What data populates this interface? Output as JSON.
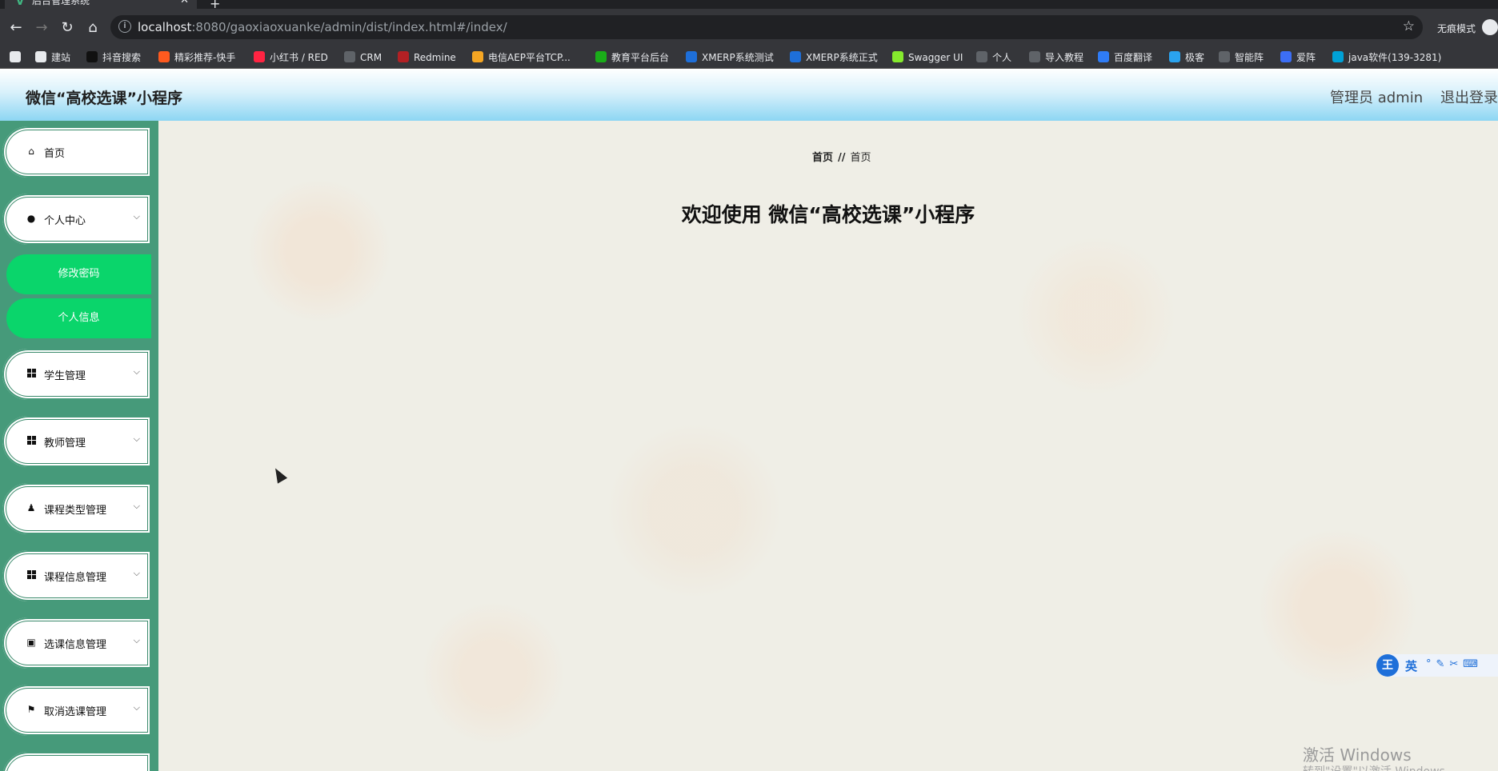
{
  "browser": {
    "tab_title": "后台管理系统",
    "url_host": "localhost",
    "url_path": ":8080/gaoxiaoxuanke/admin/dist/index.html#/index/",
    "incognito_label": "无痕模式",
    "bookmarks": [
      {
        "label": "",
        "icon": "github-icon",
        "color": "#e8eaed"
      },
      {
        "label": "建站",
        "icon": "site-icon",
        "color": "#e8eaed"
      },
      {
        "label": "抖音搜索",
        "icon": "douyin-icon",
        "color": "#111111"
      },
      {
        "label": "精彩推荐-快手",
        "icon": "kuaishou-icon",
        "color": "#ff5a1f"
      },
      {
        "label": "小红书 / RED",
        "icon": "xiaohongshu-icon",
        "color": "#ff2442"
      },
      {
        "label": "CRM",
        "icon": "globe-icon",
        "color": "#5f6368"
      },
      {
        "label": "Redmine",
        "icon": "redmine-icon",
        "color": "#b32024"
      },
      {
        "label": "电信AEP平台TCP...",
        "icon": "aep-icon",
        "color": "#f5a623"
      },
      {
        "label": "教育平台后台",
        "icon": "edu-icon",
        "color": "#1aad19"
      },
      {
        "label": "XMERP系统测试",
        "icon": "xmerp-icon",
        "color": "#1e6fd9"
      },
      {
        "label": "XMERP系统正式",
        "icon": "xmerp-icon",
        "color": "#1e6fd9"
      },
      {
        "label": "Swagger UI",
        "icon": "swagger-icon",
        "color": "#85ea2d"
      },
      {
        "label": "个人",
        "icon": "globe-icon",
        "color": "#5f6368"
      },
      {
        "label": "导入教程",
        "icon": "globe-icon",
        "color": "#5f6368"
      },
      {
        "label": "百度翻译",
        "icon": "baidu-translate-icon",
        "color": "#2f7cf6"
      },
      {
        "label": "极客",
        "icon": "telegram-icon",
        "color": "#2aa3ef"
      },
      {
        "label": "智能阵",
        "icon": "globe-icon",
        "color": "#5f6368"
      },
      {
        "label": "爱阵",
        "icon": "aizhen-icon",
        "color": "#3c6ef5"
      },
      {
        "label": "java软件(139-3281)",
        "icon": "bilibili-icon",
        "color": "#00a1d6"
      }
    ]
  },
  "header": {
    "title": "微信“高校选课”小程序",
    "admin_label": "管理员 admin",
    "logout_label": "退出登录"
  },
  "sidebar": {
    "items": [
      {
        "label": "首页",
        "icon": "home-icon"
      },
      {
        "label": "个人中心",
        "icon": "user-icon",
        "expanded": true,
        "children": [
          {
            "label": "修改密码"
          },
          {
            "label": "个人信息"
          }
        ]
      },
      {
        "label": "学生管理",
        "icon": "grid-icon"
      },
      {
        "label": "教师管理",
        "icon": "grid-icon"
      },
      {
        "label": "课程类型管理",
        "icon": "person-icon"
      },
      {
        "label": "课程信息管理",
        "icon": "grid-icon"
      },
      {
        "label": "选课信息管理",
        "icon": "clipboard-icon"
      },
      {
        "label": "取消选课管理",
        "icon": "flag-icon"
      }
    ]
  },
  "main": {
    "breadcrumb": [
      "首页",
      "首页"
    ],
    "breadcrumb_separator": "//",
    "welcome": "欢迎使用 微信“高校选课”小程序"
  },
  "ime": {
    "logo": "王",
    "mode": "英"
  },
  "os": {
    "watermark": "激活 Windows",
    "watermark_sub": "转到\"设置\"以激活 Windows。"
  },
  "colors": {
    "sidebar_bg": "#469a7a",
    "submenu_bg": "#0ad56b",
    "header_gradient_end": "#8dd6f3"
  }
}
